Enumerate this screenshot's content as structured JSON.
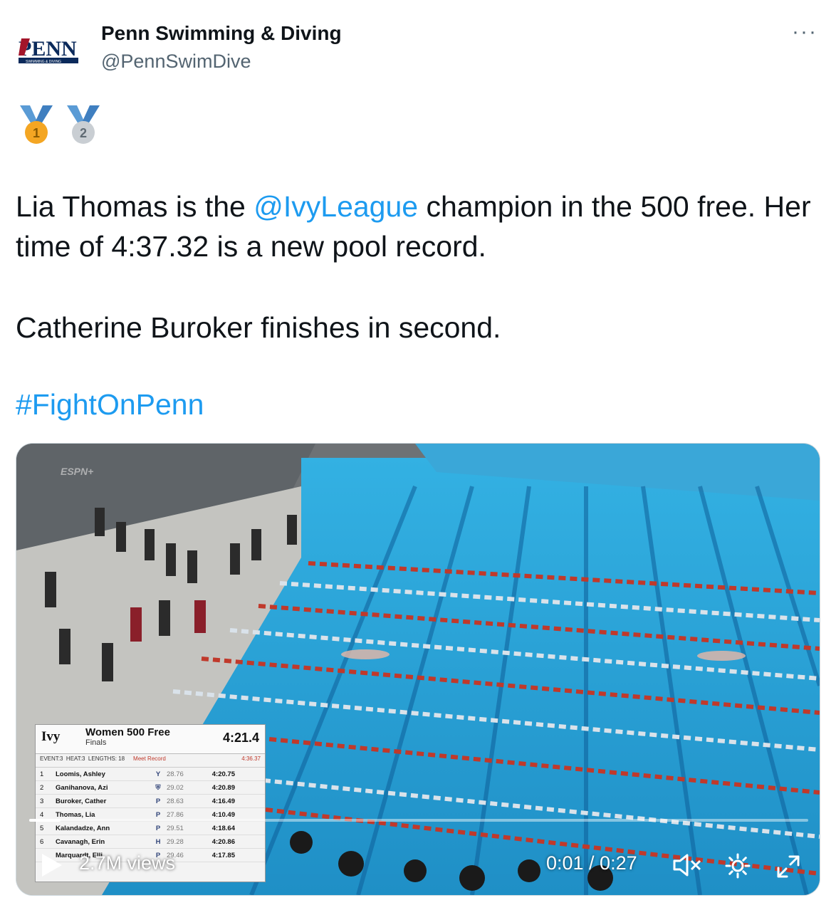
{
  "author": {
    "display_name": "Penn Swimming & Diving",
    "handle": "@PennSwimDive",
    "logo_text": "PENN",
    "logo_subtext": "SWIMMING & DIVING"
  },
  "tweet": {
    "medals": [
      {
        "number": "1",
        "icon": "1st-place-medal-icon"
      },
      {
        "number": "2",
        "icon": "2nd-place-medal-icon"
      }
    ],
    "line1_before": "Lia Thomas is the ",
    "mention": "@IvyLeague",
    "line1_after": " champion in the 500 free. Her time of 4:37.32 is a new pool record.",
    "line2": "Catherine Buroker finishes in second.",
    "hashtag": "#FightOnPenn"
  },
  "scoreboard": {
    "logo": "Ivy",
    "event": "Women 500 Free",
    "round": "Finals",
    "clock": "4:21.4",
    "event_no": "EVENT:3",
    "heat": "HEAT:3",
    "lengths": "LENGTHS: 18",
    "meet_record_label": "Meet Record",
    "meet_record_time": "4:36.37",
    "rows": [
      {
        "place": "1",
        "name": "Loomis, Ashley",
        "team": "Y",
        "split": "28.76",
        "time": "4:20.75"
      },
      {
        "place": "2",
        "name": "Ganihanova, Azi",
        "team": "⛨",
        "split": "29.02",
        "time": "4:20.89"
      },
      {
        "place": "3",
        "name": "Buroker, Cather",
        "team": "P",
        "split": "28.63",
        "time": "4:16.49"
      },
      {
        "place": "4",
        "name": "Thomas, Lia",
        "team": "P",
        "split": "27.86",
        "time": "4:10.49"
      },
      {
        "place": "5",
        "name": "Kalandadze, Ann",
        "team": "P",
        "split": "29.51",
        "time": "4:18.64"
      },
      {
        "place": "6",
        "name": "Cavanagh, Erin",
        "team": "H",
        "split": "29.28",
        "time": "4:20.86"
      },
      {
        "place": "",
        "name": "Marquardt, Elli",
        "team": "P",
        "split": "29.46",
        "time": "4:17.85"
      }
    ]
  },
  "video": {
    "views": "2.7M views",
    "time": "0:01 / 0:27",
    "progress": 0.04,
    "overlay_text": "ESPN+"
  },
  "colors": {
    "link": "#1d9bf0",
    "pool": "#2a9fd6",
    "lane_rope_red": "#c0392b"
  }
}
